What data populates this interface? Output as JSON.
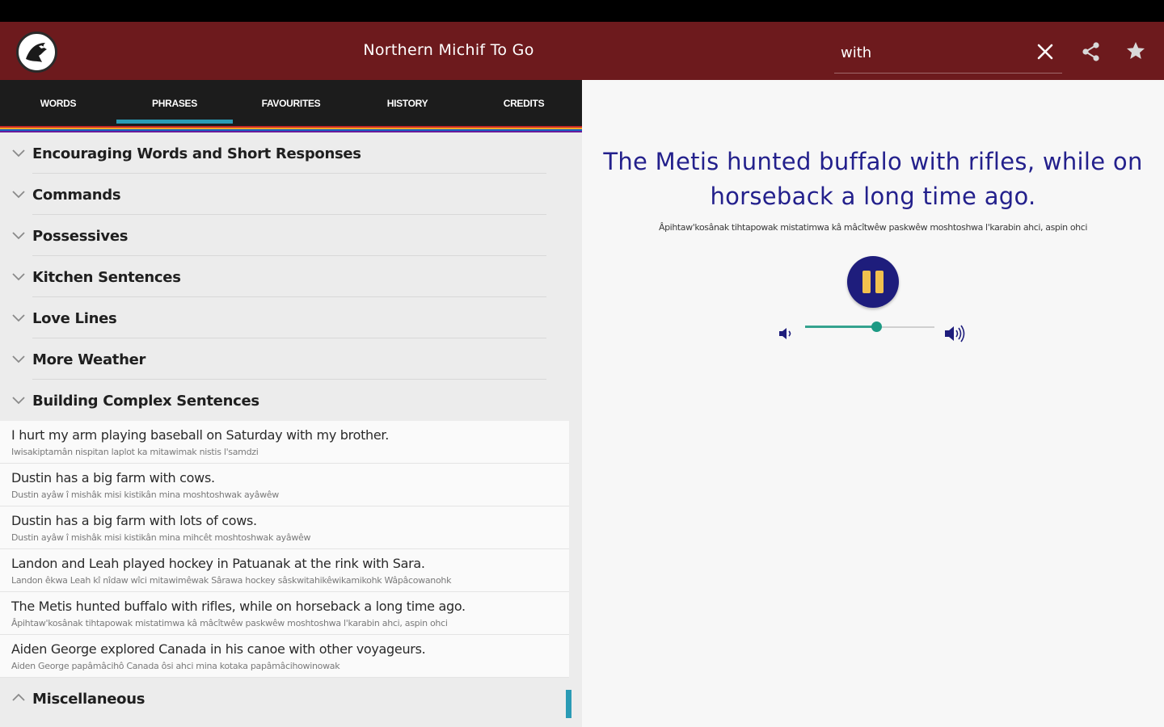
{
  "app": {
    "title": "Northern Michif To Go"
  },
  "search": {
    "value": "with"
  },
  "tabs": [
    {
      "label": "WORDS",
      "active": false
    },
    {
      "label": "PHRASES",
      "active": true
    },
    {
      "label": "FAVOURITES",
      "active": false
    },
    {
      "label": "HISTORY",
      "active": false
    },
    {
      "label": "CREDITS",
      "active": false
    }
  ],
  "categories": [
    "Encouraging Words and Short Responses",
    "Commands",
    "Possessives",
    "Kitchen Sentences",
    "Love Lines",
    "More Weather",
    "Building Complex Sentences"
  ],
  "phrases": [
    {
      "en": "I hurt my arm playing baseball on Saturday with my brother.",
      "mi": "Iwisakiptamân nispitan laplot ka mitawimak nistis l'samdzi"
    },
    {
      "en": "Dustin has a big farm with cows.",
      "mi": "Dustin ayâw î mishâk misi kistikân mina moshtoshwak ayâwêw"
    },
    {
      "en": "Dustin has a big farm with lots of cows.",
      "mi": "Dustin ayâw î mishâk misi kistikân mina mihcêt moshtoshwak ayâwêw"
    },
    {
      "en": "Landon and Leah played hockey in Patuanak at the rink with Sara.",
      "mi": "Landon êkwa Leah kî nîdaw wîci mitawimêwak Sârawa hockey sâskwitahikêwikamikohk Wâpâcowanohk"
    },
    {
      "en": "The Metis hunted buffalo with rifles, while on horseback a long time ago.",
      "mi": "Âpihtaw'kosânak tihtapowak mistatimwa kâ mâcîtwêw paskwêw moshtoshwa l'karabin ahci, aspin ohci"
    },
    {
      "en": "Aiden George  explored Canada in his canoe with other voyageurs.",
      "mi": "Aiden George papâmâcihô Canada ôsi ahci mina kotaka papâmâcihowinowak"
    }
  ],
  "expanded_category": "Miscellaneous",
  "detail": {
    "english": "The Metis hunted buffalo with rifles, while on horseback a long time ago.",
    "michif": "Âpihtaw'kosânak tihtapowak mistatimwa kâ mâcîtwêw paskwêw moshtoshwa l'karabin ahci, aspin ohci"
  },
  "player": {
    "state": "playing",
    "volume": 0.55
  },
  "icons": {
    "logo": "eagle-logo-icon",
    "clear": "close-icon",
    "share": "share-icon",
    "favourite": "star-icon",
    "pause": "pause-icon",
    "volume_low": "volume-low-icon",
    "volume_high": "volume-high-icon"
  },
  "colors": {
    "appbar": "#6d1a1d",
    "tabbar": "#1c1c1c",
    "tab_indicator": "#2a9bb5",
    "title_text": "#23208c",
    "play_button": "#1e1d7c",
    "pause_glyph": "#f2c14e",
    "slider": "#1d9a84",
    "sash": [
      "#c62828",
      "#f9a825",
      "#1565c0",
      "#6a1b9a"
    ]
  }
}
